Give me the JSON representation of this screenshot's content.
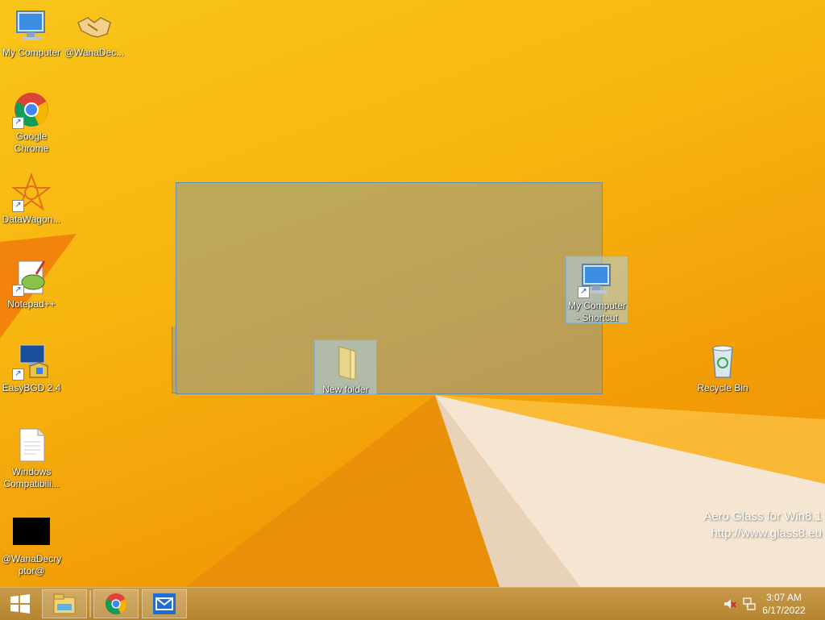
{
  "desktop": {
    "icons": [
      {
        "label": "My Computer",
        "icon": "computer-icon"
      },
      {
        "label": "@WanaDec...",
        "icon": "handshake-icon"
      },
      {
        "label": "Google Chrome",
        "icon": "chrome-icon"
      },
      {
        "label": "DataWagon...",
        "icon": "datawagon-icon"
      },
      {
        "label": "Notepad++",
        "icon": "notepadpp-icon"
      },
      {
        "label": "EasyBGD 2.4",
        "icon": "easybgd-icon"
      },
      {
        "label": "Windows Compatibili...",
        "icon": "document-icon"
      },
      {
        "label": "@WanaDecryptor@",
        "icon": "black-window-icon"
      },
      {
        "label": "My Computer - Shortcut",
        "icon": "computer-icon"
      },
      {
        "label": "New folder",
        "icon": "folder-icon"
      },
      {
        "label": "Recycle Bin",
        "icon": "recycle-bin-icon"
      }
    ],
    "watermark": {
      "line1": "Aero Glass for Win8.1",
      "line2": "http://www.glass8.eu"
    }
  },
  "taskbar": {
    "buttons": [
      {
        "name": "start",
        "icon": "windows-logo-icon"
      },
      {
        "name": "file-explorer",
        "icon": "file-explorer-icon"
      },
      {
        "name": "chrome",
        "icon": "chrome-icon"
      },
      {
        "name": "mail",
        "icon": "mail-icon"
      }
    ],
    "tray": {
      "volume": "speaker-muted-icon",
      "network": "network-icon"
    },
    "clock": {
      "time": "3:07 AM",
      "date": "6/17/2022"
    }
  },
  "colors": {
    "wallpaper_primary": "#f7b40f",
    "selection": "#7896b4",
    "taskbar": "#b58530"
  }
}
